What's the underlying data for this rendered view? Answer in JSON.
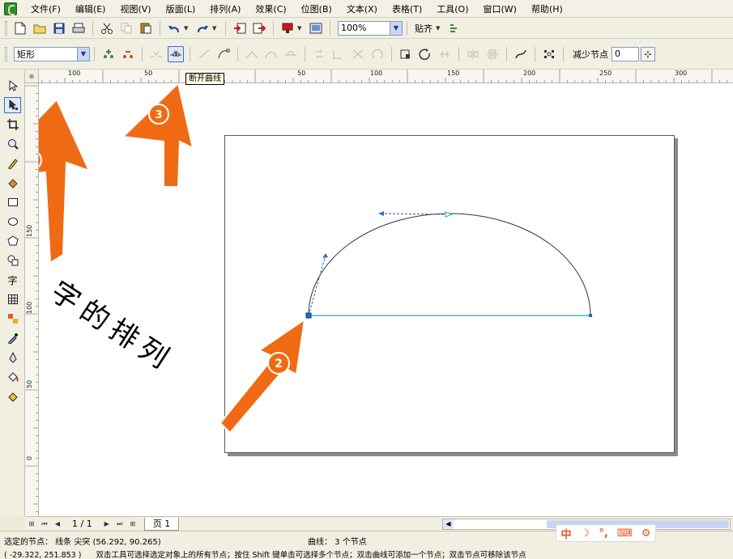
{
  "menu": [
    "文件(F)",
    "编辑(E)",
    "视图(V)",
    "版面(L)",
    "排列(A)",
    "效果(C)",
    "位图(B)",
    "文本(X)",
    "表格(T)",
    "工具(O)",
    "窗口(W)",
    "帮助(H)"
  ],
  "toolbar": {
    "zoom_value": "100%",
    "snap_label": "贴齐",
    "shape_type": "矩形",
    "reduce_nodes_label": "减少节点",
    "reduce_nodes_value": "0",
    "tooltip": "断开曲线"
  },
  "icons": {
    "app": "coreldraw-app-icon",
    "toolbar1": [
      "new-icon",
      "open-icon",
      "save-icon",
      "print-icon",
      "cut-icon",
      "copy-icon",
      "paste-icon",
      "undo-icon",
      "redo-icon",
      "import-icon",
      "export-icon",
      "publish-icon",
      "welcome-icon",
      "snap-options-icon"
    ],
    "toolbar2": [
      "add-node-icon",
      "delete-node-icon",
      "join-nodes-icon",
      "break-curve-icon",
      "to-line-icon",
      "to-curve-icon",
      "cusp-icon",
      "smooth-icon",
      "symmetrical-icon",
      "reverse-direction-icon",
      "extend-curve-icon",
      "stretch-nodes-icon",
      "rotate-nodes-icon",
      "align-nodes-icon",
      "extract-subpath-icon",
      "auto-close-icon",
      "reflect-h-icon",
      "reflect-v-icon",
      "elastic-mode-icon",
      "select-all-nodes-icon"
    ],
    "tools": [
      "pick-tool-icon",
      "shape-tool-icon",
      "crop-tool-icon",
      "zoom-tool-icon",
      "freehand-tool-icon",
      "smart-fill-icon",
      "rectangle-tool-icon",
      "ellipse-tool-icon",
      "polygon-tool-icon",
      "basic-shapes-icon",
      "text-tool-icon",
      "table-tool-icon",
      "interactive-blend-icon",
      "eyedropper-icon",
      "outline-pen-icon",
      "fill-tool-icon",
      "interactive-fill-icon"
    ]
  },
  "toolbox": {
    "text_tool_glyph": "字"
  },
  "ruler": {
    "h_labels": [
      "100",
      "50",
      "50",
      "100",
      "150",
      "200",
      "250",
      "300"
    ],
    "v_labels": [
      "150",
      "100",
      "50",
      "0"
    ]
  },
  "canvas_text": "字的排列",
  "annotations": [
    "1",
    "2",
    "3"
  ],
  "annotation_color": "#f06a14",
  "page_bar": {
    "counter": "1 / 1",
    "page_tab": "页 1"
  },
  "ime_bar": [
    "中",
    "☽",
    "°,",
    "⌨",
    "⚙"
  ],
  "status": {
    "selected": "选定的节点： 线条 尖突 (56.292, 90.265)",
    "curve": "曲线： 3 个节点",
    "coords": "( -29.322, 251.853 )",
    "hint": "双击工具可选择选定对象上的所有节点；按住 Shift 键单击可选择多个节点；双击曲线可添加一个节点；双击节点可移除该节点"
  }
}
